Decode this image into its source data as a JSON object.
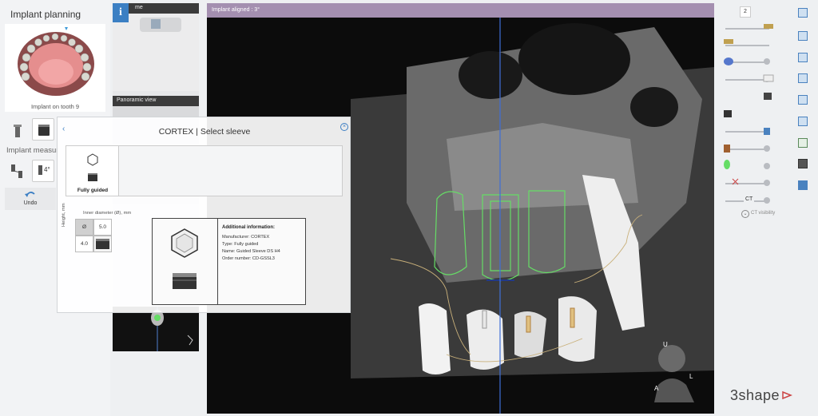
{
  "left_panel": {
    "title": "Implant planning",
    "implant_caption": "Implant on tooth 9",
    "measure_section": "Implant measur",
    "undo_label": "Undo"
  },
  "middle_column": {
    "view1_label": "me",
    "view2_label": "Panoramic view"
  },
  "main_view": {
    "header": "Implant aligned : 3°",
    "orientation": {
      "superior": "U",
      "left": "L",
      "anterior": "A"
    }
  },
  "right_toolbar": {
    "counter": "2",
    "ct_label": "CT",
    "ct_visibility": "CT visibility"
  },
  "dialog": {
    "title": "CORTEX | Select sleeve",
    "option_label": "Fully guided",
    "inner_diameter_label": "Inner diameter (Ø), mm",
    "height_label": "Height, mm",
    "dims": {
      "diameter_symbol": "Ø",
      "diameter_value": "5.0",
      "height_value": "4.0"
    },
    "info_title": "Additional information:",
    "info_lines": {
      "manufacturer": "Manufacturer: CORTEX",
      "type": "Type: Fully guided",
      "name": "Name: Guided Sleeve DS H4",
      "order": "Order number: CD-GSSL3"
    }
  },
  "brand": "3shape",
  "colors": {
    "header_bar": "#a48fb0",
    "accent_blue": "#3d7fc4",
    "implant_green": "#66dd66",
    "implant_orange": "#d09840"
  }
}
